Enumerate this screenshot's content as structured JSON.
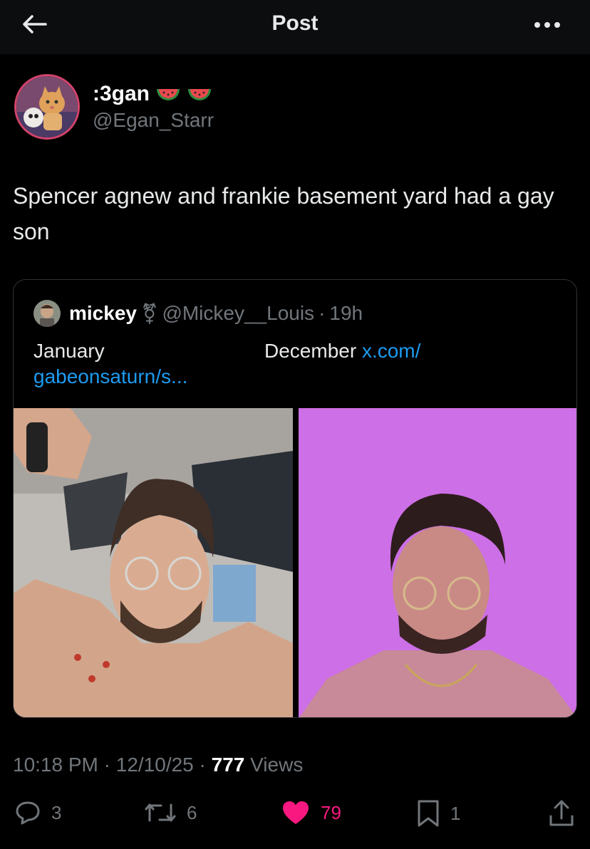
{
  "header": {
    "title": "Post"
  },
  "author": {
    "display_name": ":3gan",
    "handle": "@Egan_Starr"
  },
  "tweet": {
    "text": "Spencer agnew and frankie basement yard had a gay son"
  },
  "quote": {
    "display_name": "mickey",
    "gender_symbol": "⚧",
    "handle": "@Mickey__Louis",
    "separator": "·",
    "time": "19h",
    "text_january": "January",
    "text_december": "December",
    "link_part1": "x.com/",
    "link_part2": "gabeonsaturn/s..."
  },
  "meta": {
    "time": "10:18 PM",
    "sep1": "·",
    "date": "12/10/25",
    "sep2": "·",
    "views_count": "777",
    "views_label": "Views"
  },
  "actions": {
    "replies": "3",
    "reposts": "6",
    "likes": "79",
    "bookmarks": "1"
  },
  "colors": {
    "accent_blue": "#1d9bf0",
    "like_pink": "#f91880",
    "avatar_border": "#d2436b"
  }
}
